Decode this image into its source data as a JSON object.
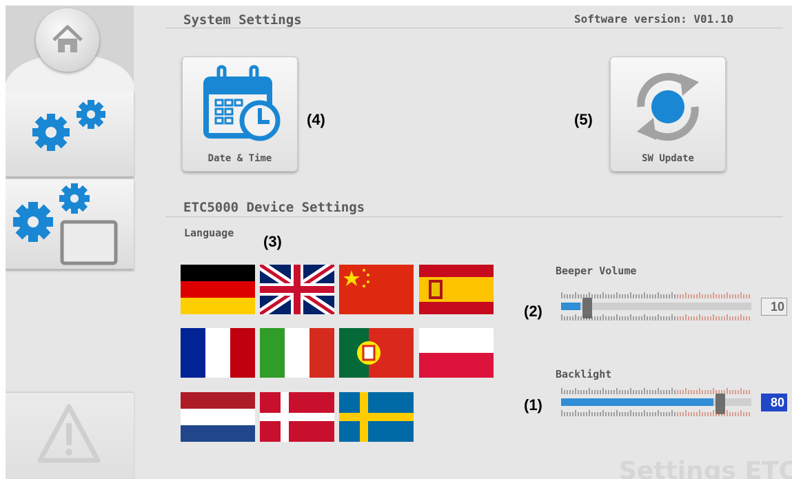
{
  "header": {
    "system_settings": "System Settings",
    "software_version": "Software version:  V01.10"
  },
  "buttons": {
    "date_time": "Date & Time",
    "sw_update": "SW Update"
  },
  "callouts": {
    "c1": "(1)",
    "c2": "(2)",
    "c3": "(3)",
    "c4": "(4)",
    "c5": "(5)"
  },
  "device": {
    "title": "ETC5000 Device Settings",
    "language_label": "Language",
    "languages": [
      "German",
      "English",
      "Chinese",
      "Spanish",
      "French",
      "Italian",
      "Portuguese",
      "Polish",
      "Dutch",
      "Danish",
      "Swedish"
    ]
  },
  "beeper": {
    "label": "Beeper Volume",
    "value": "10",
    "level": 0.1
  },
  "backlight": {
    "label": "Backlight",
    "value": "80",
    "level": 0.8
  },
  "watermark": "Settings ETC",
  "icons": [
    "home-icon",
    "gears-icon",
    "gears-display-icon",
    "warning-icon",
    "calendar-clock-icon",
    "refresh-icon"
  ],
  "colors": {
    "accent": "#1a87d4",
    "value_active": "#2047c8"
  }
}
